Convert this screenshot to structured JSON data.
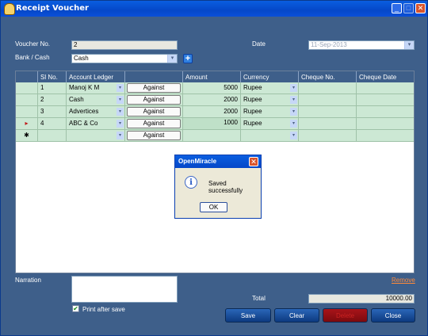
{
  "window": {
    "title": "Receipt Voucher",
    "minimize": "_",
    "maximize": "□",
    "close": "✕"
  },
  "form": {
    "voucher_label": "Voucher No.",
    "voucher_value": "2",
    "date_label": "Date",
    "date_value": "11-Sep-2013",
    "bank_label": "Bank / Cash",
    "bank_value": "Cash",
    "add_symbol": "+",
    "dropdown_glyph": "▾"
  },
  "grid": {
    "columns": [
      "Sl No.",
      "Account Ledger",
      "",
      "Amount",
      "Currency",
      "Cheque No.",
      "Cheque Date"
    ],
    "against_label": "Against",
    "rows": [
      {
        "sl": "1",
        "ledger": "Manoj K M",
        "amount": "5000",
        "currency": "Rupee"
      },
      {
        "sl": "2",
        "ledger": "Cash",
        "amount": "2000",
        "currency": "Rupee"
      },
      {
        "sl": "3",
        "ledger": "Advertices",
        "amount": "2000",
        "currency": "Rupee"
      },
      {
        "sl": "4",
        "ledger": "ABC & Co",
        "amount": "1000",
        "currency": "Rupee"
      }
    ],
    "current_row_marker": "▸",
    "new_row_marker": "✱"
  },
  "dialog": {
    "title": "OpenMiracle",
    "message": "Saved successfully",
    "ok_label": "OK",
    "close": "✕",
    "icon": "info-icon",
    "icon_glyph": "i"
  },
  "footer": {
    "narration_label": "Narration",
    "narration_value": "",
    "print_after_save_label": "Print after save",
    "print_after_save_checked": true,
    "checkmark": "✔",
    "remove_link": "Remove",
    "total_label": "Total",
    "total_value": "10000.00",
    "save_label": "Save",
    "clear_label": "Clear",
    "delete_label": "Delete",
    "close_label": "Close"
  },
  "colors": {
    "window_bg": "#3e5f8a",
    "grid_row": "#cce8d4",
    "titlebar": "#0547c8",
    "button_blue": "#0d3a80",
    "button_red": "#a8141a",
    "link": "#ff8a3a"
  }
}
